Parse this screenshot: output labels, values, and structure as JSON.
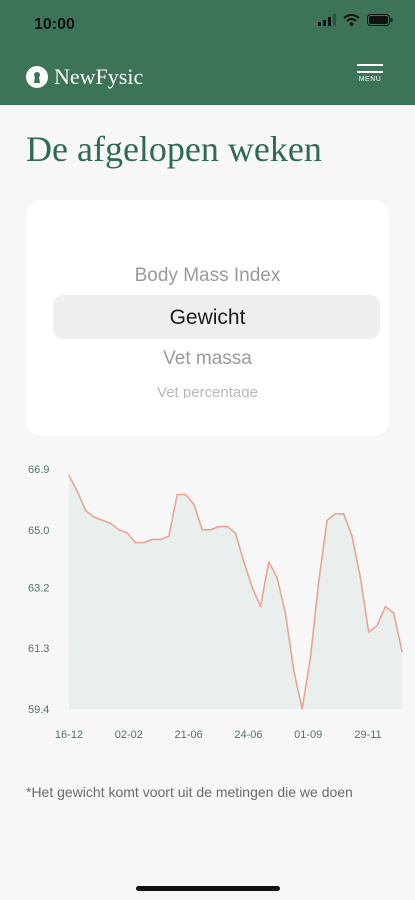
{
  "status_bar": {
    "time": "10:00"
  },
  "header": {
    "brand": "NewFysic",
    "menu_label": "MENU"
  },
  "page_title": "De afgelopen weken",
  "picker": {
    "options": [
      "Body Mass Index",
      "Gewicht",
      "Vet massa",
      "Vet percentage"
    ],
    "selected": "Gewicht"
  },
  "chart_data": {
    "type": "area",
    "title": "",
    "xlabel": "",
    "ylabel": "",
    "y_ticks": [
      "66.9",
      "65.0",
      "63.2",
      "61.3",
      "59.4"
    ],
    "ylim": [
      59.4,
      66.9
    ],
    "x_ticks": [
      "16-12",
      "02-02",
      "21-06",
      "24-06",
      "01-09",
      "29-11"
    ],
    "values": [
      66.7,
      66.2,
      65.6,
      65.4,
      65.3,
      65.2,
      65.0,
      64.9,
      64.6,
      64.6,
      64.7,
      64.7,
      64.8,
      66.1,
      66.1,
      65.8,
      65.0,
      65.0,
      65.1,
      65.1,
      64.9,
      64.0,
      63.2,
      62.6,
      64.0,
      63.5,
      62.4,
      60.6,
      59.4,
      61.0,
      63.4,
      65.3,
      65.5,
      65.5,
      64.8,
      63.5,
      61.8,
      62.0,
      62.6,
      62.4,
      61.2
    ],
    "grid": false,
    "line_color": "#e8a594",
    "fill_color": "#e9efec"
  },
  "footnote": "*Het gewicht komt voort uit de metingen die we doen"
}
